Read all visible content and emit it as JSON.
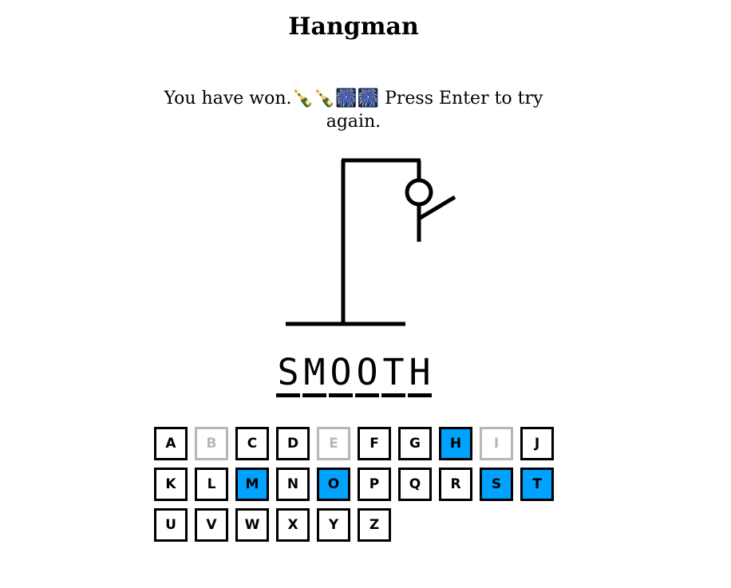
{
  "title": "Hangman",
  "message": "You have won.🍾🍾🎆🎆 Press Enter to try again.",
  "word": [
    "S",
    "M",
    "O",
    "O",
    "T",
    "H"
  ],
  "colors": {
    "correct": "#00a2ff",
    "disabled": "#b7b7b7",
    "default": "#000000"
  },
  "keyboard": [
    {
      "letter": "A",
      "state": "default"
    },
    {
      "letter": "B",
      "state": "disabled"
    },
    {
      "letter": "C",
      "state": "default"
    },
    {
      "letter": "D",
      "state": "default"
    },
    {
      "letter": "E",
      "state": "disabled"
    },
    {
      "letter": "F",
      "state": "default"
    },
    {
      "letter": "G",
      "state": "default"
    },
    {
      "letter": "H",
      "state": "correct"
    },
    {
      "letter": "I",
      "state": "disabled"
    },
    {
      "letter": "J",
      "state": "default"
    },
    {
      "letter": "K",
      "state": "default"
    },
    {
      "letter": "L",
      "state": "default"
    },
    {
      "letter": "M",
      "state": "correct"
    },
    {
      "letter": "N",
      "state": "default"
    },
    {
      "letter": "O",
      "state": "correct"
    },
    {
      "letter": "P",
      "state": "default"
    },
    {
      "letter": "Q",
      "state": "default"
    },
    {
      "letter": "R",
      "state": "default"
    },
    {
      "letter": "S",
      "state": "correct"
    },
    {
      "letter": "T",
      "state": "correct"
    },
    {
      "letter": "U",
      "state": "default"
    },
    {
      "letter": "V",
      "state": "default"
    },
    {
      "letter": "W",
      "state": "default"
    },
    {
      "letter": "X",
      "state": "default"
    },
    {
      "letter": "Y",
      "state": "default"
    },
    {
      "letter": "Z",
      "state": "default"
    }
  ],
  "hangman": {
    "wrong_guesses": 3,
    "parts_shown": [
      "head",
      "body",
      "left-arm"
    ]
  }
}
